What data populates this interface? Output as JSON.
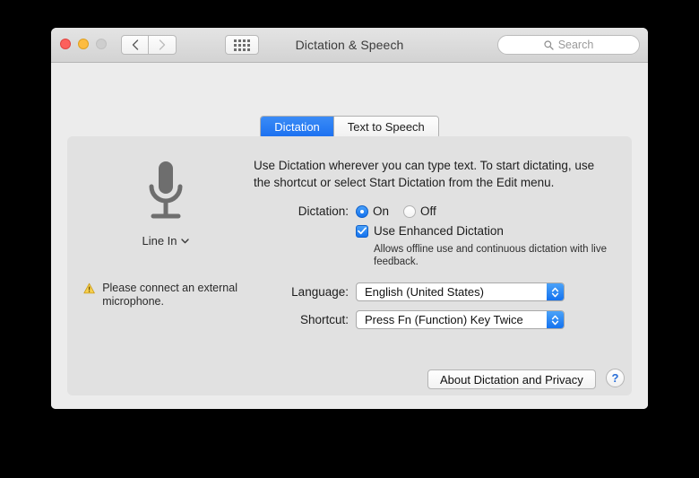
{
  "window": {
    "title": "Dictation & Speech",
    "traffic_lights": [
      "close-button",
      "minimize-button",
      "zoom-button"
    ],
    "nav": {
      "back": "back-button",
      "forward": "forward-button",
      "show_all": "show-all-button"
    },
    "search": {
      "placeholder": "Search",
      "value": "",
      "icon": "search-icon"
    }
  },
  "tabs": [
    {
      "label": "Dictation",
      "selected": true
    },
    {
      "label": "Text to Speech",
      "selected": false
    }
  ],
  "mic": {
    "icon": "microphone-icon",
    "source_label": "Line In",
    "source_chevron": "chevron-down-icon",
    "warning_icon": "warning-triangle-icon",
    "warning_text": "Please connect an external microphone."
  },
  "main": {
    "intro": "Use Dictation wherever you can type text. To start dictating, use the shortcut or select Start Dictation from the Edit menu.",
    "dictation": {
      "label": "Dictation:",
      "options": [
        {
          "label": "On",
          "selected": true
        },
        {
          "label": "Off",
          "selected": false
        }
      ]
    },
    "enhanced": {
      "label": "Use Enhanced Dictation",
      "checked": true,
      "note": "Allows offline use and continuous dictation with live feedback."
    },
    "language": {
      "label": "Language:",
      "value": "English (United States)"
    },
    "shortcut": {
      "label": "Shortcut:",
      "value": "Press Fn (Function) Key Twice"
    }
  },
  "footer": {
    "about_button": "About Dictation and Privacy",
    "help_button": "?"
  },
  "colors": {
    "accent_blue": "#1472ef",
    "window_bg": "#ececec",
    "panel_bg": "#e1e1e1",
    "warning_yellow": "#f4c430"
  }
}
